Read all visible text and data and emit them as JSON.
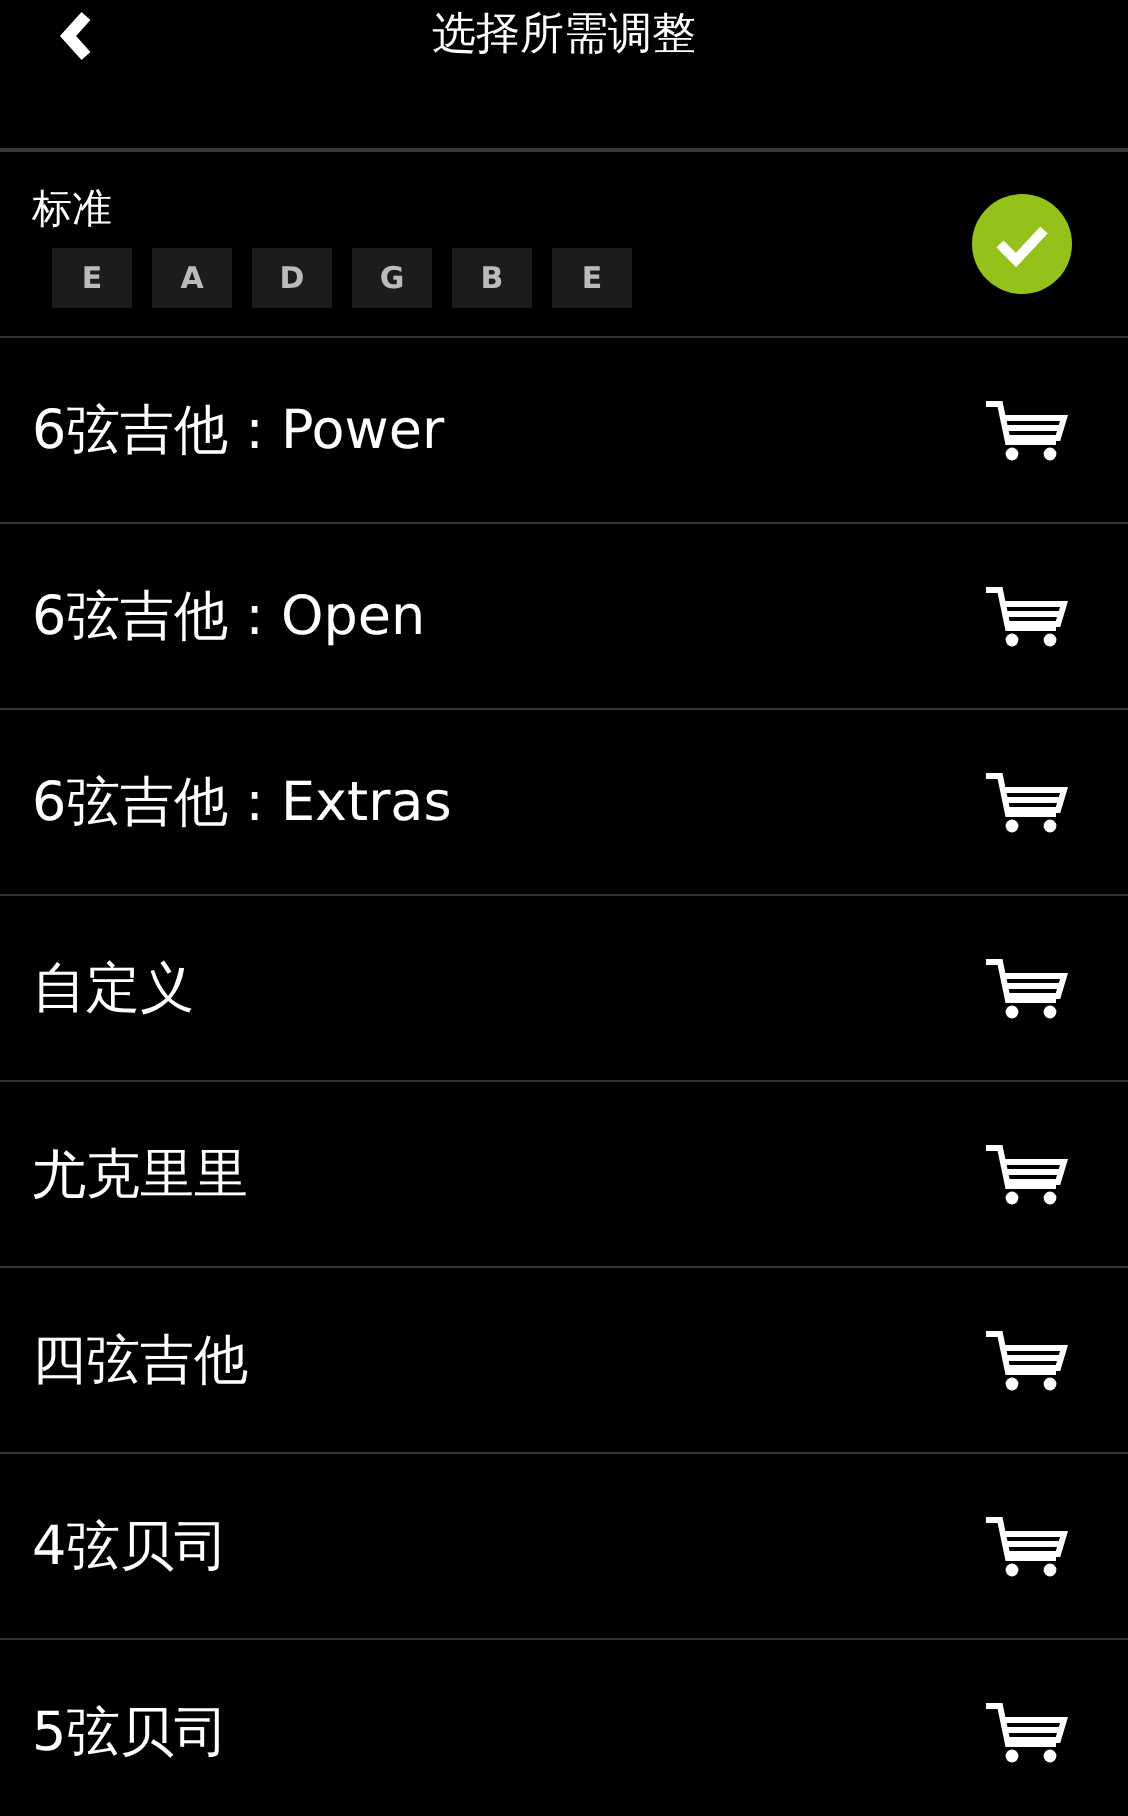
{
  "header": {
    "title": "选择所需调整"
  },
  "tunings": [
    {
      "name": "标准",
      "notes": [
        "E",
        "A",
        "D",
        "G",
        "B",
        "E"
      ],
      "selected": true
    },
    {
      "name": "6弦吉他 : Power",
      "selected": false
    },
    {
      "name": "6弦吉他 : Open",
      "selected": false
    },
    {
      "name": "6弦吉他 : Extras",
      "selected": false
    },
    {
      "name": "自定义",
      "selected": false
    },
    {
      "name": "尤克里里",
      "selected": false
    },
    {
      "name": "四弦吉他",
      "selected": false
    },
    {
      "name": "4弦贝司",
      "selected": false
    },
    {
      "name": "5弦贝司",
      "selected": false
    }
  ]
}
